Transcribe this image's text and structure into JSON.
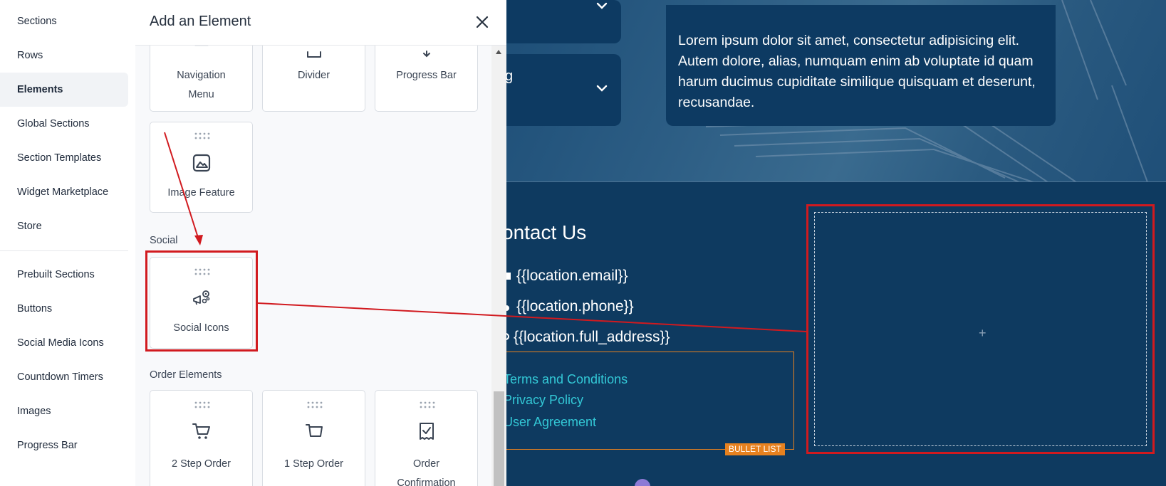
{
  "sidebar": {
    "items": [
      {
        "label": "Sections"
      },
      {
        "label": "Rows"
      },
      {
        "label": "Elements"
      },
      {
        "label": "Global Sections"
      },
      {
        "label": "Section Templates"
      },
      {
        "label": "Widget Marketplace"
      },
      {
        "label": "Store"
      },
      {
        "label": "Prebuilt Sections"
      },
      {
        "label": "Buttons"
      },
      {
        "label": "Social Media Icons"
      },
      {
        "label": "Countdown Timers"
      },
      {
        "label": "Images"
      },
      {
        "label": "Progress Bar"
      }
    ],
    "active": "Elements"
  },
  "panel": {
    "title": "Add an Element",
    "close_icon": "close-icon",
    "top_cards": [
      {
        "label": "Navigation Menu",
        "icon": "navigation-menu-icon"
      },
      {
        "label": "Divider",
        "icon": "divider-icon"
      },
      {
        "label": "Progress Bar",
        "icon": "progress-bar-icon"
      }
    ],
    "image_feature": {
      "label": "Image Feature",
      "icon": "image-icon"
    },
    "social_section": {
      "title": "Social",
      "card": {
        "label": "Social Icons",
        "icon": "social-icons-icon"
      }
    },
    "order_section": {
      "title": "Order Elements",
      "cards": [
        {
          "label": "2 Step Order",
          "icon": "cart-icon"
        },
        {
          "label": "1 Step Order",
          "icon": "cart-icon"
        },
        {
          "label": "Order Confirmation",
          "icon": "receipt-check-icon"
        }
      ]
    }
  },
  "canvas": {
    "accordion_partial_text": "g",
    "lorem": "Lorem ipsum dolor sit amet, consectetur adipisicing elit. Autem dolore, alias, numquam enim ab voluptate id quam harum ducimus cupiditate similique quisquam et deserunt, recusandae.",
    "contact_title": "ontact Us",
    "contact_lines": [
      "{{location.email}}",
      "{{location.phone}}",
      "{{location.full_address}}"
    ],
    "bullet_links": [
      "Terms and Conditions",
      "Privacy Policy",
      "User Agreement"
    ],
    "bullet_tag": "BULLET LIST",
    "drop_plus": "+"
  },
  "colors": {
    "canvas_bg": "#0e3a60",
    "highlight_red": "#d11a1f",
    "link_teal": "#33c8d6",
    "tag_orange": "#e6811f"
  }
}
